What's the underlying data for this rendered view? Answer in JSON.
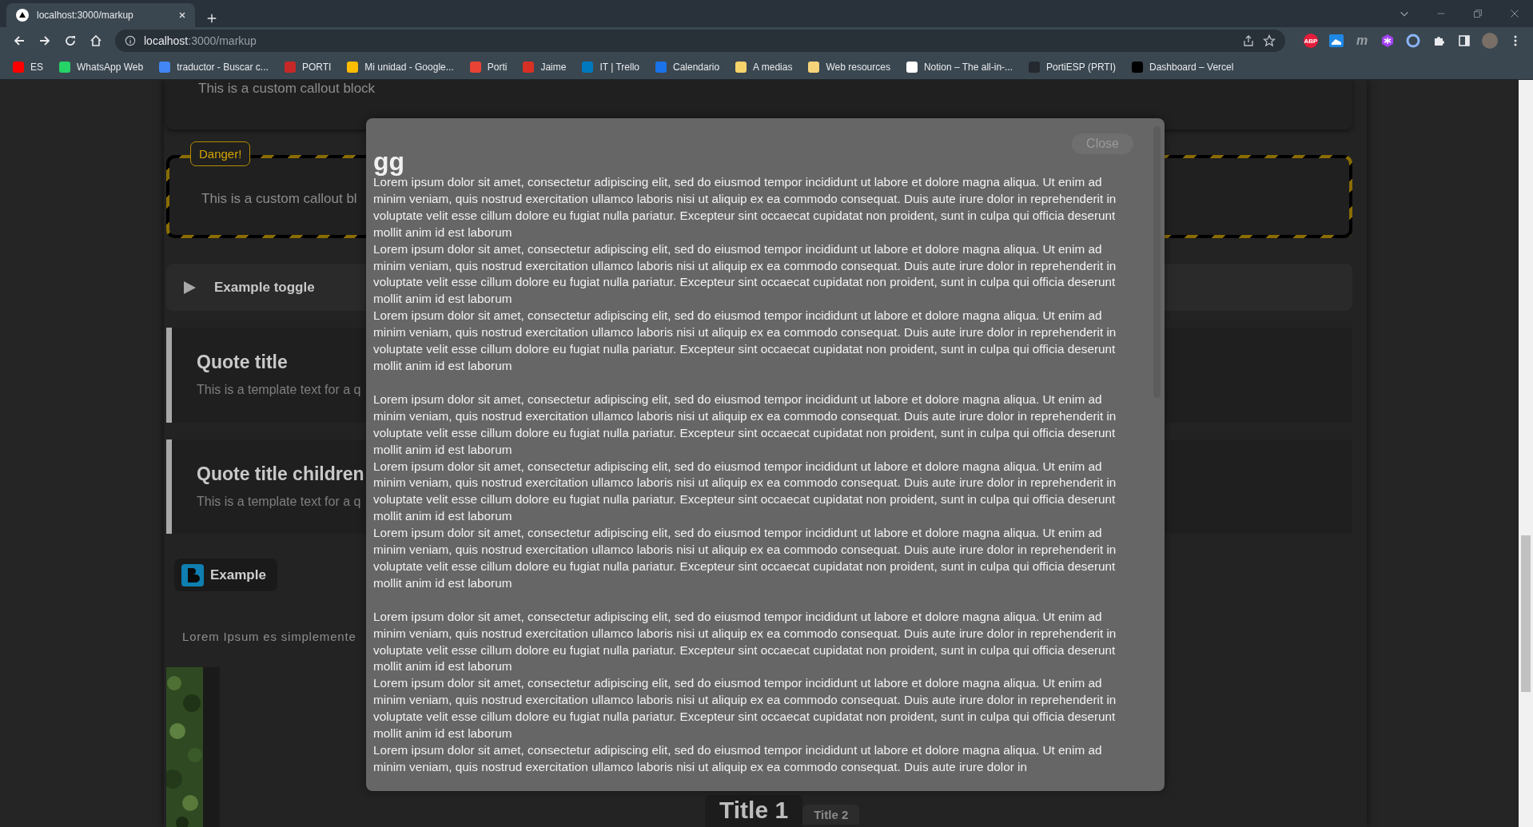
{
  "browser": {
    "tab": {
      "title": "localhost:3000/markup"
    },
    "url": {
      "host": "localhost",
      "path": ":3000/markup"
    },
    "bookmarks": [
      {
        "label": "ES",
        "color": "#ff0000"
      },
      {
        "label": "WhatsApp Web",
        "color": "#25d366"
      },
      {
        "label": "traductor - Buscar c...",
        "color": "#4285f4"
      },
      {
        "label": "PORTI",
        "color": "#c62828"
      },
      {
        "label": "Mi unidad - Google...",
        "color": "#fbbc04"
      },
      {
        "label": "Porti",
        "color": "#ea4335"
      },
      {
        "label": "Jaime",
        "color": "#d93025"
      },
      {
        "label": "IT | Trello",
        "color": "#0079bf"
      },
      {
        "label": "Calendario",
        "color": "#1a73e8"
      },
      {
        "label": "A medias",
        "color": "#f6d36b"
      },
      {
        "label": "Web resources",
        "color": "#f5d47a"
      },
      {
        "label": "Notion – The all-in-...",
        "color": "#ffffff"
      },
      {
        "label": "PortiESP (PRTI)",
        "color": "#24292f"
      },
      {
        "label": "Dashboard – Vercel",
        "color": "#000000"
      }
    ],
    "extensions": [
      {
        "kind": "badge",
        "label": "ABP",
        "color": "#e51c3a"
      },
      {
        "kind": "square",
        "color": "#1e88e5"
      },
      {
        "kind": "letter",
        "label": "m",
        "color": "#9aa0a6"
      },
      {
        "kind": "hexagon",
        "color": "#a142f4"
      },
      {
        "kind": "ring",
        "color": "#8ab4f8"
      }
    ]
  },
  "page": {
    "callout_top": {
      "text": "This is a custom callout block"
    },
    "danger_callout": {
      "badge": "Danger!",
      "text": "This is a custom callout bl"
    },
    "toggle": {
      "label": "Example toggle",
      "expanded": false
    },
    "quotes": [
      {
        "title": "Quote title",
        "text": "This is a template text for a q"
      },
      {
        "title": "Quote title children",
        "text": "This is a template text for a q"
      }
    ],
    "example_button": {
      "label": "Example"
    },
    "paragraph": "Lorem Ipsum es simplemente",
    "title_tabs": [
      {
        "label": "Title 1",
        "selected": true
      },
      {
        "label": "Title 2",
        "selected": false
      }
    ]
  },
  "modal": {
    "title": "gg",
    "close": "Close",
    "groups": [
      [
        "Lorem ipsum dolor sit amet, consectetur adipiscing elit, sed do eiusmod tempor incididunt ut labore et dolore magna aliqua. Ut enim ad minim veniam, quis nostrud exercitation ullamco laboris nisi ut aliquip ex ea commodo consequat. Duis aute irure dolor in reprehenderit in voluptate velit esse cillum dolore eu fugiat nulla pariatur. Excepteur sint occaecat cupidatat non proident, sunt in culpa qui officia deserunt mollit anim id est laborum",
        "Lorem ipsum dolor sit amet, consectetur adipiscing elit, sed do eiusmod tempor incididunt ut labore et dolore magna aliqua. Ut enim ad minim veniam, quis nostrud exercitation ullamco laboris nisi ut aliquip ex ea commodo consequat. Duis aute irure dolor in reprehenderit in voluptate velit esse cillum dolore eu fugiat nulla pariatur. Excepteur sint occaecat cupidatat non proident, sunt in culpa qui officia deserunt mollit anim id est laborum",
        "Lorem ipsum dolor sit amet, consectetur adipiscing elit, sed do eiusmod tempor incididunt ut labore et dolore magna aliqua. Ut enim ad minim veniam, quis nostrud exercitation ullamco laboris nisi ut aliquip ex ea commodo consequat. Duis aute irure dolor in reprehenderit in voluptate velit esse cillum dolore eu fugiat nulla pariatur. Excepteur sint occaecat cupidatat non proident, sunt in culpa qui officia deserunt mollit anim id est laborum"
      ],
      [
        "Lorem ipsum dolor sit amet, consectetur adipiscing elit, sed do eiusmod tempor incididunt ut labore et dolore magna aliqua. Ut enim ad minim veniam, quis nostrud exercitation ullamco laboris nisi ut aliquip ex ea commodo consequat. Duis aute irure dolor in reprehenderit in voluptate velit esse cillum dolore eu fugiat nulla pariatur. Excepteur sint occaecat cupidatat non proident, sunt in culpa qui officia deserunt mollit anim id est laborum",
        "Lorem ipsum dolor sit amet, consectetur adipiscing elit, sed do eiusmod tempor incididunt ut labore et dolore magna aliqua. Ut enim ad minim veniam, quis nostrud exercitation ullamco laboris nisi ut aliquip ex ea commodo consequat. Duis aute irure dolor in reprehenderit in voluptate velit esse cillum dolore eu fugiat nulla pariatur. Excepteur sint occaecat cupidatat non proident, sunt in culpa qui officia deserunt mollit anim id est laborum",
        "Lorem ipsum dolor sit amet, consectetur adipiscing elit, sed do eiusmod tempor incididunt ut labore et dolore magna aliqua. Ut enim ad minim veniam, quis nostrud exercitation ullamco laboris nisi ut aliquip ex ea commodo consequat. Duis aute irure dolor in reprehenderit in voluptate velit esse cillum dolore eu fugiat nulla pariatur. Excepteur sint occaecat cupidatat non proident, sunt in culpa qui officia deserunt mollit anim id est laborum"
      ],
      [
        "Lorem ipsum dolor sit amet, consectetur adipiscing elit, sed do eiusmod tempor incididunt ut labore et dolore magna aliqua. Ut enim ad minim veniam, quis nostrud exercitation ullamco laboris nisi ut aliquip ex ea commodo consequat. Duis aute irure dolor in reprehenderit in voluptate velit esse cillum dolore eu fugiat nulla pariatur. Excepteur sint occaecat cupidatat non proident, sunt in culpa qui officia deserunt mollit anim id est laborum",
        "Lorem ipsum dolor sit amet, consectetur adipiscing elit, sed do eiusmod tempor incididunt ut labore et dolore magna aliqua. Ut enim ad minim veniam, quis nostrud exercitation ullamco laboris nisi ut aliquip ex ea commodo consequat. Duis aute irure dolor in reprehenderit in voluptate velit esse cillum dolore eu fugiat nulla pariatur. Excepteur sint occaecat cupidatat non proident, sunt in culpa qui officia deserunt mollit anim id est laborum",
        "Lorem ipsum dolor sit amet, consectetur adipiscing elit, sed do eiusmod tempor incididunt ut labore et dolore magna aliqua. Ut enim ad minim veniam, quis nostrud exercitation ullamco laboris nisi ut aliquip ex ea commodo consequat. Duis aute irure dolor in"
      ]
    ]
  }
}
